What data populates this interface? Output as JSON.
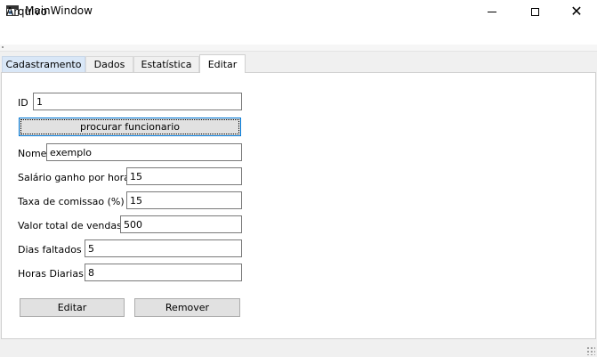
{
  "window": {
    "title": "MainWindow",
    "controls": {
      "minimize": "minimize-icon",
      "maximize": "maximize-icon",
      "close": "close-icon",
      "close_glyph": "✕"
    }
  },
  "menu": {
    "items": [
      {
        "label": "Arquivo"
      }
    ]
  },
  "tabs": [
    {
      "label": "Cadastramento",
      "state": "hover"
    },
    {
      "label": "Dados",
      "state": "normal"
    },
    {
      "label": "Estatística",
      "state": "normal"
    },
    {
      "label": "Editar",
      "state": "selected"
    }
  ],
  "form": {
    "id": {
      "label": "ID",
      "value": "1"
    },
    "search_button": "procurar funcionario",
    "nome": {
      "label": "Nome",
      "value": "exemplo"
    },
    "salario": {
      "label": "Salário ganho por hora :",
      "value": "15"
    },
    "comissao": {
      "label": "Taxa de comissao (%) :",
      "value": "15"
    },
    "vendas": {
      "label": "Valor total de vendas :",
      "value": "500"
    },
    "faltas": {
      "label": "Dias faltados :",
      "value": "5"
    },
    "horas": {
      "label": "Horas Diarias :",
      "value": "8"
    },
    "edit_button": "Editar",
    "remove_button": "Remover"
  },
  "colors": {
    "accent": "#0078d7",
    "tab_hover": "#d9e7f7",
    "button_face": "#e1e1e1"
  }
}
